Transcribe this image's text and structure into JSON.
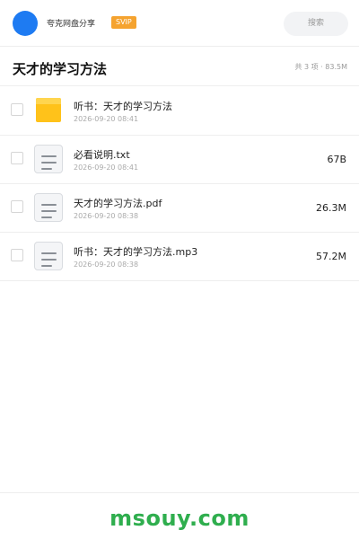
{
  "header": {
    "app_name": "夸克网盘分享",
    "badge": "SVIP",
    "search_label": "搜索"
  },
  "folder": {
    "title": "天才的学习方法",
    "meta": "共 3 项 · 83.5M"
  },
  "files": [
    {
      "icon": "folder-icon",
      "name": "听书：天才的学习方法",
      "date": "2026-09-20 08:41",
      "size": ""
    },
    {
      "icon": "document-icon",
      "name": "必看说明.txt",
      "date": "2026-09-20 08:41",
      "size": "67B"
    },
    {
      "icon": "document-icon",
      "name": "天才的学习方法.pdf",
      "date": "2026-09-20 08:38",
      "size": "26.3M"
    },
    {
      "icon": "document-icon",
      "name": "听书：天才的学习方法.mp3",
      "date": "2026-09-20 08:38",
      "size": "57.2M"
    }
  ],
  "watermark": "msouy.com",
  "colors": {
    "avatar": "#1e7bf2",
    "badge": "#f5a32f",
    "folder": "#ffc21a",
    "watermark": "#2fae4e"
  }
}
